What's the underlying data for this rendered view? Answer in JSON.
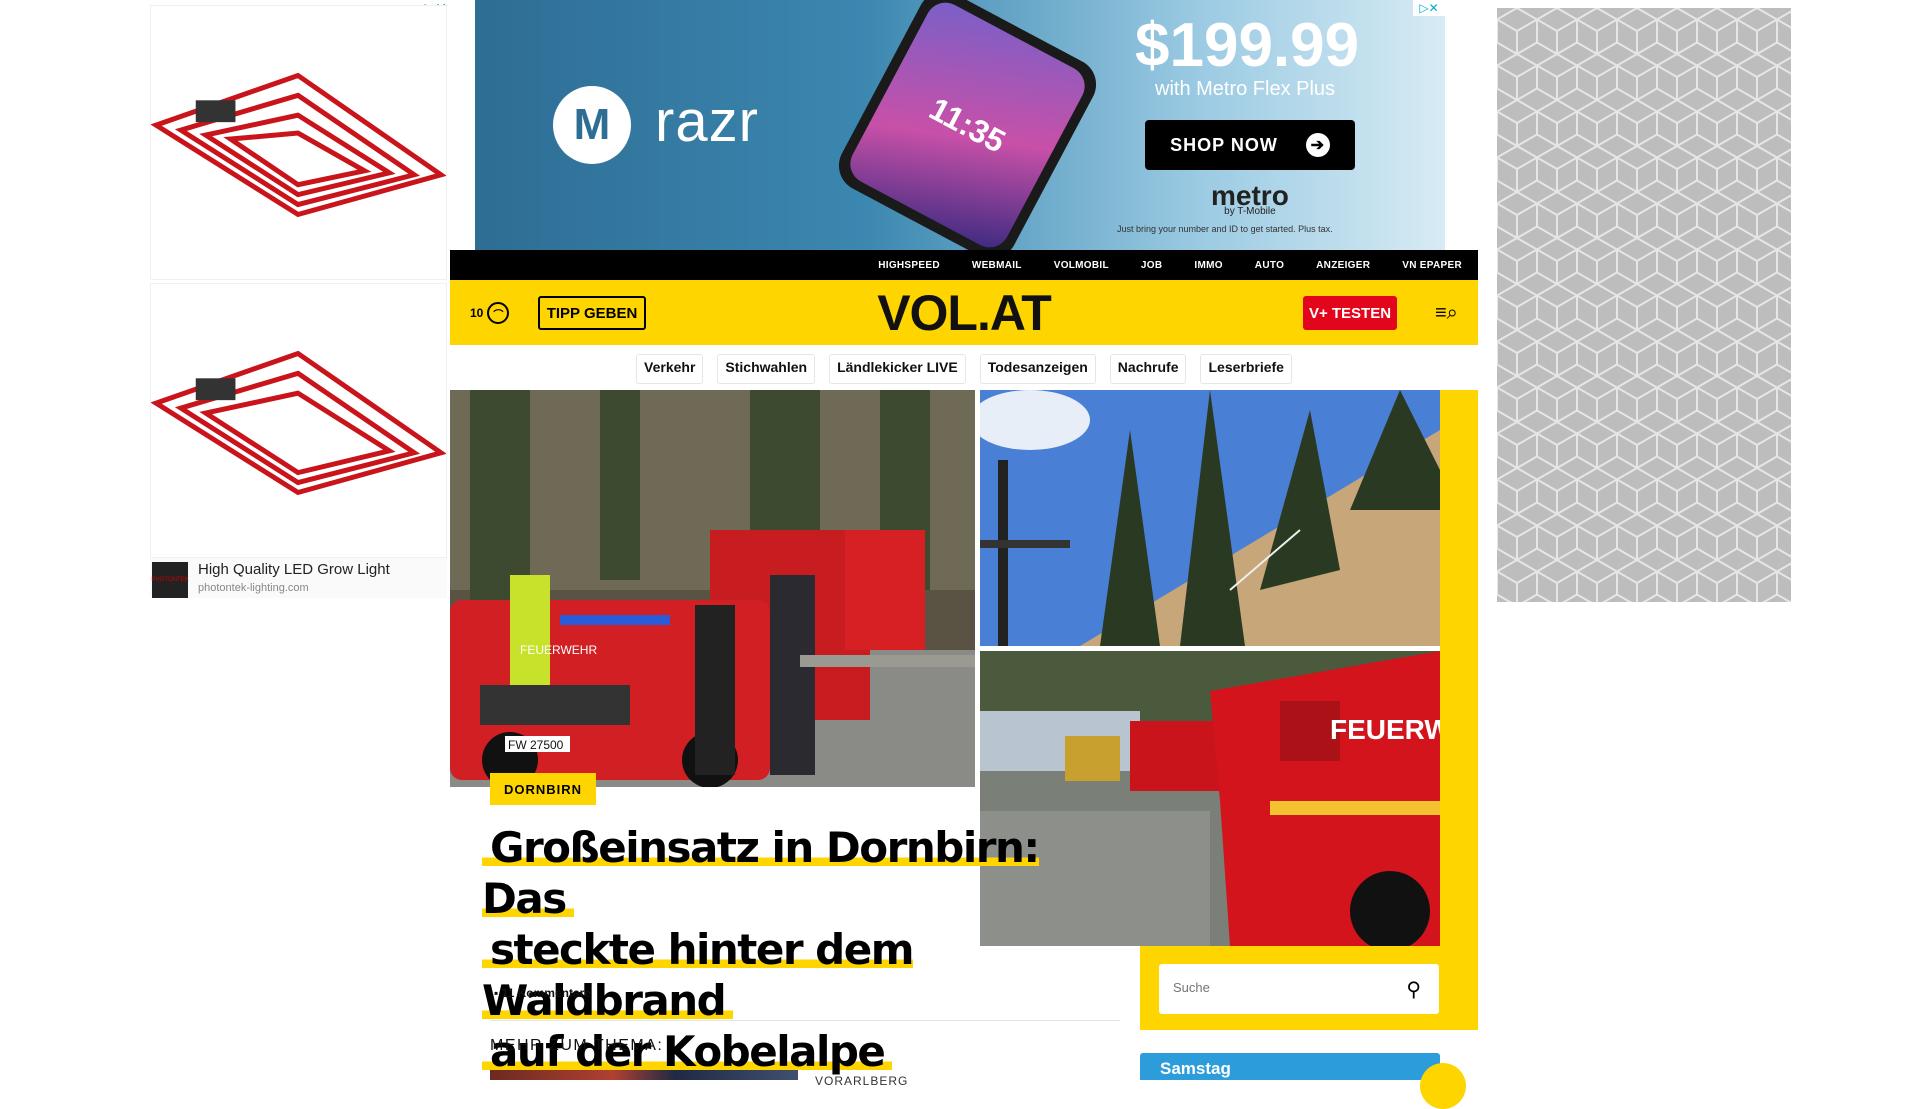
{
  "ads": {
    "left": {
      "title": "High Quality LED Grow Light",
      "domain": "photontek-lighting.com",
      "logo_text": "PHOTONTEK"
    },
    "top": {
      "brand": "razr",
      "phone_time": "11:35",
      "price": "$199.99",
      "subtitle": "with Metro Flex Plus",
      "cta": "SHOP NOW",
      "carrier": "metro",
      "carrier_sub": "by T-Mobile",
      "fine_print": "Just bring your number and ID to get started. Plus tax."
    }
  },
  "topnav": [
    "HIGHSPEED",
    "WEBMAIL",
    "VOLMOBIL",
    "JOB",
    "IMMO",
    "AUTO",
    "ANZEIGER",
    "VN EPAPER"
  ],
  "header": {
    "temperature": "10",
    "tipp": "TIPP GEBEN",
    "logo": "VOL.AT",
    "vplus": "V+ TESTEN"
  },
  "tags": [
    "Verkehr",
    "Stichwahlen",
    "Ländlekicker LIVE",
    "Todesanzeigen",
    "Nachrufe",
    "Leserbriefe"
  ],
  "article": {
    "section": "DORNBIRN",
    "headline_lines": [
      "Großeinsatz in Dornbirn: Das",
      "steckte hinter dem Waldbrand",
      "auf der Kobelalpe"
    ],
    "comments": "11 Kommentare",
    "more_title": "MEHR ZUM THEMA:",
    "related_section": "VORARLBERG",
    "image_texts": {
      "plate": "FW 27500",
      "truck": "FEUERWEHR",
      "van": "FEUERW"
    }
  },
  "search": {
    "placeholder": "Suche"
  },
  "weather_widget": {
    "day": "Samstag"
  },
  "colors": {
    "brand_yellow": "#ffd500",
    "vplus_red": "#e3051b",
    "weather_blue": "#2d9cdb"
  }
}
